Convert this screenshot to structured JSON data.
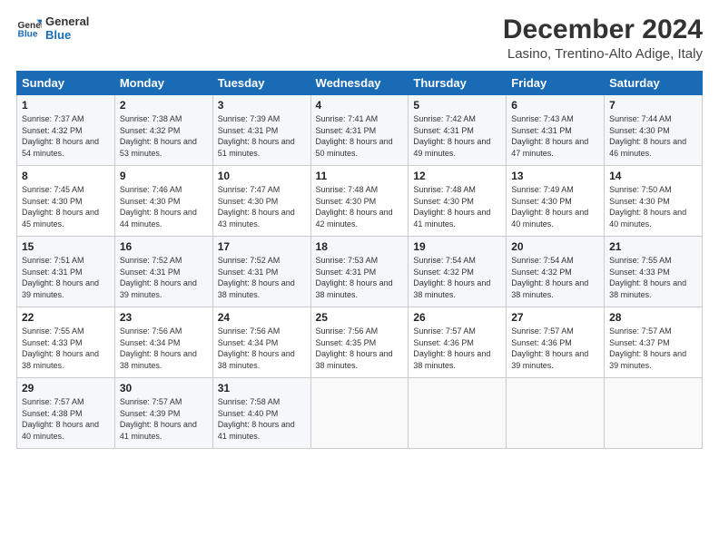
{
  "header": {
    "logo_line1": "General",
    "logo_line2": "Blue",
    "month_title": "December 2024",
    "location": "Lasino, Trentino-Alto Adige, Italy"
  },
  "days_of_week": [
    "Sunday",
    "Monday",
    "Tuesday",
    "Wednesday",
    "Thursday",
    "Friday",
    "Saturday"
  ],
  "weeks": [
    [
      {
        "day": "1",
        "sunrise": "Sunrise: 7:37 AM",
        "sunset": "Sunset: 4:32 PM",
        "daylight": "Daylight: 8 hours and 54 minutes."
      },
      {
        "day": "2",
        "sunrise": "Sunrise: 7:38 AM",
        "sunset": "Sunset: 4:32 PM",
        "daylight": "Daylight: 8 hours and 53 minutes."
      },
      {
        "day": "3",
        "sunrise": "Sunrise: 7:39 AM",
        "sunset": "Sunset: 4:31 PM",
        "daylight": "Daylight: 8 hours and 51 minutes."
      },
      {
        "day": "4",
        "sunrise": "Sunrise: 7:41 AM",
        "sunset": "Sunset: 4:31 PM",
        "daylight": "Daylight: 8 hours and 50 minutes."
      },
      {
        "day": "5",
        "sunrise": "Sunrise: 7:42 AM",
        "sunset": "Sunset: 4:31 PM",
        "daylight": "Daylight: 8 hours and 49 minutes."
      },
      {
        "day": "6",
        "sunrise": "Sunrise: 7:43 AM",
        "sunset": "Sunset: 4:31 PM",
        "daylight": "Daylight: 8 hours and 47 minutes."
      },
      {
        "day": "7",
        "sunrise": "Sunrise: 7:44 AM",
        "sunset": "Sunset: 4:30 PM",
        "daylight": "Daylight: 8 hours and 46 minutes."
      }
    ],
    [
      {
        "day": "8",
        "sunrise": "Sunrise: 7:45 AM",
        "sunset": "Sunset: 4:30 PM",
        "daylight": "Daylight: 8 hours and 45 minutes."
      },
      {
        "day": "9",
        "sunrise": "Sunrise: 7:46 AM",
        "sunset": "Sunset: 4:30 PM",
        "daylight": "Daylight: 8 hours and 44 minutes."
      },
      {
        "day": "10",
        "sunrise": "Sunrise: 7:47 AM",
        "sunset": "Sunset: 4:30 PM",
        "daylight": "Daylight: 8 hours and 43 minutes."
      },
      {
        "day": "11",
        "sunrise": "Sunrise: 7:48 AM",
        "sunset": "Sunset: 4:30 PM",
        "daylight": "Daylight: 8 hours and 42 minutes."
      },
      {
        "day": "12",
        "sunrise": "Sunrise: 7:48 AM",
        "sunset": "Sunset: 4:30 PM",
        "daylight": "Daylight: 8 hours and 41 minutes."
      },
      {
        "day": "13",
        "sunrise": "Sunrise: 7:49 AM",
        "sunset": "Sunset: 4:30 PM",
        "daylight": "Daylight: 8 hours and 40 minutes."
      },
      {
        "day": "14",
        "sunrise": "Sunrise: 7:50 AM",
        "sunset": "Sunset: 4:30 PM",
        "daylight": "Daylight: 8 hours and 40 minutes."
      }
    ],
    [
      {
        "day": "15",
        "sunrise": "Sunrise: 7:51 AM",
        "sunset": "Sunset: 4:31 PM",
        "daylight": "Daylight: 8 hours and 39 minutes."
      },
      {
        "day": "16",
        "sunrise": "Sunrise: 7:52 AM",
        "sunset": "Sunset: 4:31 PM",
        "daylight": "Daylight: 8 hours and 39 minutes."
      },
      {
        "day": "17",
        "sunrise": "Sunrise: 7:52 AM",
        "sunset": "Sunset: 4:31 PM",
        "daylight": "Daylight: 8 hours and 38 minutes."
      },
      {
        "day": "18",
        "sunrise": "Sunrise: 7:53 AM",
        "sunset": "Sunset: 4:31 PM",
        "daylight": "Daylight: 8 hours and 38 minutes."
      },
      {
        "day": "19",
        "sunrise": "Sunrise: 7:54 AM",
        "sunset": "Sunset: 4:32 PM",
        "daylight": "Daylight: 8 hours and 38 minutes."
      },
      {
        "day": "20",
        "sunrise": "Sunrise: 7:54 AM",
        "sunset": "Sunset: 4:32 PM",
        "daylight": "Daylight: 8 hours and 38 minutes."
      },
      {
        "day": "21",
        "sunrise": "Sunrise: 7:55 AM",
        "sunset": "Sunset: 4:33 PM",
        "daylight": "Daylight: 8 hours and 38 minutes."
      }
    ],
    [
      {
        "day": "22",
        "sunrise": "Sunrise: 7:55 AM",
        "sunset": "Sunset: 4:33 PM",
        "daylight": "Daylight: 8 hours and 38 minutes."
      },
      {
        "day": "23",
        "sunrise": "Sunrise: 7:56 AM",
        "sunset": "Sunset: 4:34 PM",
        "daylight": "Daylight: 8 hours and 38 minutes."
      },
      {
        "day": "24",
        "sunrise": "Sunrise: 7:56 AM",
        "sunset": "Sunset: 4:34 PM",
        "daylight": "Daylight: 8 hours and 38 minutes."
      },
      {
        "day": "25",
        "sunrise": "Sunrise: 7:56 AM",
        "sunset": "Sunset: 4:35 PM",
        "daylight": "Daylight: 8 hours and 38 minutes."
      },
      {
        "day": "26",
        "sunrise": "Sunrise: 7:57 AM",
        "sunset": "Sunset: 4:36 PM",
        "daylight": "Daylight: 8 hours and 38 minutes."
      },
      {
        "day": "27",
        "sunrise": "Sunrise: 7:57 AM",
        "sunset": "Sunset: 4:36 PM",
        "daylight": "Daylight: 8 hours and 39 minutes."
      },
      {
        "day": "28",
        "sunrise": "Sunrise: 7:57 AM",
        "sunset": "Sunset: 4:37 PM",
        "daylight": "Daylight: 8 hours and 39 minutes."
      }
    ],
    [
      {
        "day": "29",
        "sunrise": "Sunrise: 7:57 AM",
        "sunset": "Sunset: 4:38 PM",
        "daylight": "Daylight: 8 hours and 40 minutes."
      },
      {
        "day": "30",
        "sunrise": "Sunrise: 7:57 AM",
        "sunset": "Sunset: 4:39 PM",
        "daylight": "Daylight: 8 hours and 41 minutes."
      },
      {
        "day": "31",
        "sunrise": "Sunrise: 7:58 AM",
        "sunset": "Sunset: 4:40 PM",
        "daylight": "Daylight: 8 hours and 41 minutes."
      },
      null,
      null,
      null,
      null
    ]
  ]
}
